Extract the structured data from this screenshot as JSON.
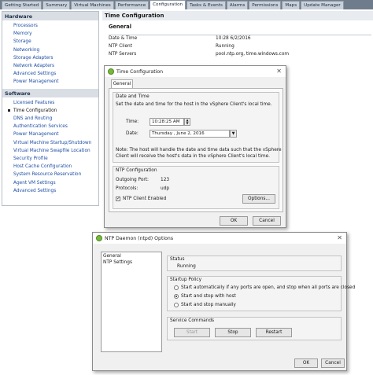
{
  "tabs": [
    "Getting Started",
    "Summary",
    "Virtual Machines",
    "Performance",
    "Configuration",
    "Tasks & Events",
    "Alarms",
    "Permissions",
    "Maps",
    "Update Manager"
  ],
  "active_tab": "Configuration",
  "hardware": {
    "heading": "Hardware",
    "items": [
      "Processors",
      "Memory",
      "Storage",
      "Networking",
      "Storage Adapters",
      "Network Adapters",
      "Advanced Settings",
      "Power Management"
    ]
  },
  "software": {
    "heading": "Software",
    "items": [
      "Licensed Features",
      "Time Configuration",
      "DNS and Routing",
      "Authentication Services",
      "Power Management",
      "Virtual Machine Startup/Shutdown",
      "Virtual Machine Swapfile Location",
      "Security Profile",
      "Host Cache Configuration",
      "System Resource Reservation",
      "Agent VM Settings",
      "Advanced Settings"
    ],
    "selected": "Time Configuration"
  },
  "main": {
    "title": "Time Configuration",
    "general_heading": "General",
    "rows": [
      {
        "label": "Date & Time",
        "value": "10:28  6/2/2016"
      },
      {
        "label": "NTP Client",
        "value": "Running"
      },
      {
        "label": "NTP Servers",
        "value": "pool.ntp.org,  time.windows.com"
      }
    ]
  },
  "time_dialog": {
    "title": "Time Configuration",
    "tab": "General",
    "date_time_group": "Date and Time",
    "instruction": "Set the date and time for the host in the vSphere Client's local time.",
    "time_label": "Time:",
    "time_value": "10:28:25 AM",
    "date_label": "Date:",
    "date_value": "Thursday  ,    June       2, 2016",
    "note_line1": "Note: The host will handle the date and time data such that the vSphere",
    "note_line2": "Client will receive the host's data in the vSphere Client's local time.",
    "ntp_group": "NTP Configuration",
    "port_label": "Outgoing Port:",
    "port_value": "123",
    "protocols_label": "Protocols:",
    "protocols_value": "udp",
    "ntp_enabled_label": "NTP Client Enabled",
    "options_button": "Options...",
    "ok_button": "OK",
    "cancel_button": "Cancel"
  },
  "ntp_dialog": {
    "title": "NTP Daemon (ntpd) Options",
    "nav_items": [
      "General",
      "NTP Settings"
    ],
    "status_group": "Status",
    "status_value": "Running",
    "policy_group": "Startup Policy",
    "policy_options": [
      "Start automatically if any ports are open, and stop when all ports are closed",
      "Start and stop with host",
      "Start and stop manually"
    ],
    "policy_selected_index": 1,
    "commands_group": "Service Commands",
    "start_button": "Start",
    "stop_button": "Stop",
    "restart_button": "Restart",
    "ok_button": "OK",
    "cancel_button": "Cancel"
  },
  "colors": {
    "link": "#1f4fa5",
    "tabbar": "#6f7c8c",
    "vmware_icon": "#78b83c"
  },
  "icons": {
    "dialog": "vmware-leaf-icon",
    "close": "close-icon",
    "selected_bullet": "bullet-icon",
    "spin": "spinner-icon",
    "dropdown": "chevron-down-icon"
  }
}
